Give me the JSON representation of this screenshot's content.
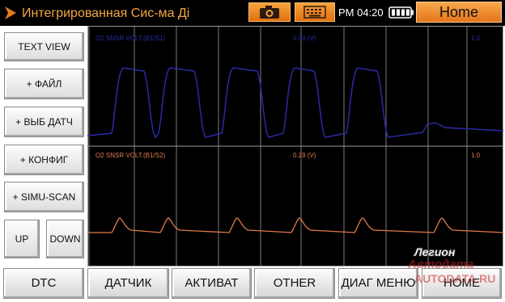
{
  "titlebar": {
    "app_title": "Интегрированная Сис-ма Ді",
    "camera_icon": "camera-icon",
    "keyboard_icon": "keyboard-icon",
    "clock": "PM 04:20",
    "battery_icon": "battery-icon",
    "home_label": "Home"
  },
  "sidebar": {
    "text_view": "TEXT VIEW",
    "file": "+ ФАЙЛ",
    "select_sensor": "+ ВЫБ ДАТЧ",
    "config": "+ КОНФИГ",
    "simu_scan": "+ SIMU-SCAN",
    "up": "UP",
    "down": "DOWN"
  },
  "graph_top": {
    "name": "O2 SNSR VOLT.(B1/S1)",
    "value": "0.80 (V)",
    "max": "1.0",
    "color": "#2a2aa8"
  },
  "graph_bottom": {
    "name": "O2 SNSR VOLT.(B1/S2)",
    "value": "0.29 (V)",
    "max": "1.0",
    "color": "#e07a4a"
  },
  "bottom": {
    "dtc": "DTC",
    "sensor": "ДАТЧИК",
    "activate": "АКТИВАТ",
    "other": "OTHER",
    "diag_menu": "ДИАГ МЕНЮ",
    "home": "HOME"
  },
  "watermark": {
    "line1": "Легион",
    "line2": "Автодата",
    "line3": "AUTODATA.RU"
  }
}
